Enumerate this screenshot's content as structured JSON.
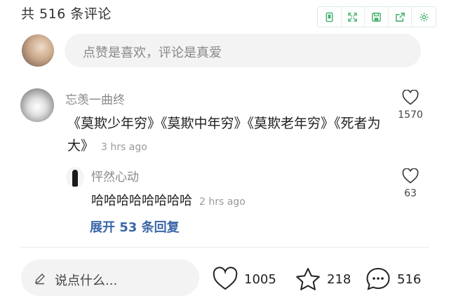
{
  "header": {
    "count_text": "共 516 条评论"
  },
  "toolbar": {
    "icons": [
      "mobile-icon",
      "expand-icon",
      "save-icon",
      "share-icon",
      "settings-icon"
    ],
    "accent": "#3fae6a"
  },
  "compose": {
    "placeholder": "点赞是喜欢，评论是真爱"
  },
  "comment": {
    "author": "忘羡一曲终",
    "text": "《莫欺少年穷》《莫欺中年穷》《莫欺老年穷》《死者为大》",
    "time": "3 hrs ago",
    "likes": "1570"
  },
  "reply": {
    "author": "怦然心动",
    "text": "哈哈哈哈哈哈哈哈",
    "time": "2 hrs ago",
    "likes": "63"
  },
  "expand_label": "展开 53 条回复",
  "bottom": {
    "input_placeholder": "说点什么...",
    "likes": "1005",
    "favorites": "218",
    "comments": "516"
  }
}
